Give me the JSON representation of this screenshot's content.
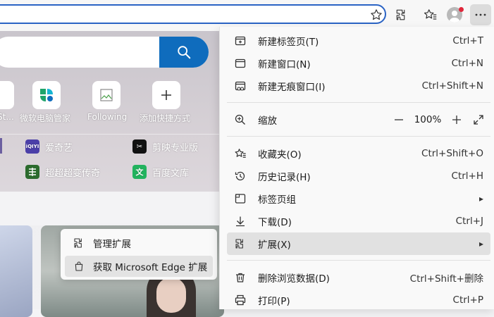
{
  "toolbar": {
    "icons": [
      "star-add-icon",
      "extensions-icon",
      "favorites-icon",
      "profile-avatar",
      "more-menu-icon"
    ]
  },
  "ntp": {
    "tiles": [
      {
        "label": "St..."
      },
      {
        "label": "微软电脑管家"
      },
      {
        "label": "Following"
      },
      {
        "label": "添加快捷方式"
      }
    ],
    "links": [
      {
        "label": "爱奇艺",
        "icon_text": "iQIYI",
        "color": "#4b3fa8"
      },
      {
        "label": "剪映专业版",
        "icon_text": "✂",
        "color": "#111111"
      },
      {
        "label": "超超超变传奇",
        "icon_text": "",
        "color": "#2c6b2e"
      },
      {
        "label": "百度文库",
        "icon_text": "文",
        "color": "#22b35e"
      }
    ]
  },
  "menu": {
    "items": [
      {
        "label": "新建标签页(T)",
        "shortcut": "Ctrl+T"
      },
      {
        "label": "新建窗口(N)",
        "shortcut": "Ctrl+N"
      },
      {
        "label": "新建无痕窗口(I)",
        "shortcut": "Ctrl+Shift+N"
      },
      {
        "label": "缩放",
        "value": "100%"
      },
      {
        "label": "收藏夹(O)",
        "shortcut": "Ctrl+Shift+O"
      },
      {
        "label": "历史记录(H)",
        "shortcut": "Ctrl+H"
      },
      {
        "label": "标签页组",
        "arrow": "▸"
      },
      {
        "label": "下载(D)",
        "shortcut": "Ctrl+J"
      },
      {
        "label": "扩展(X)",
        "arrow": "▸"
      },
      {
        "label": "删除浏览数据(D)",
        "shortcut": "Ctrl+Shift+删除"
      },
      {
        "label": "打印(P)",
        "shortcut": "Ctrl+P"
      }
    ]
  },
  "submenu": {
    "items": [
      {
        "label": "管理扩展"
      },
      {
        "label": "获取 Microsoft Edge 扩展"
      }
    ]
  },
  "colors": {
    "accent": "#0f6cbd",
    "address_border": "#2a63c4"
  }
}
